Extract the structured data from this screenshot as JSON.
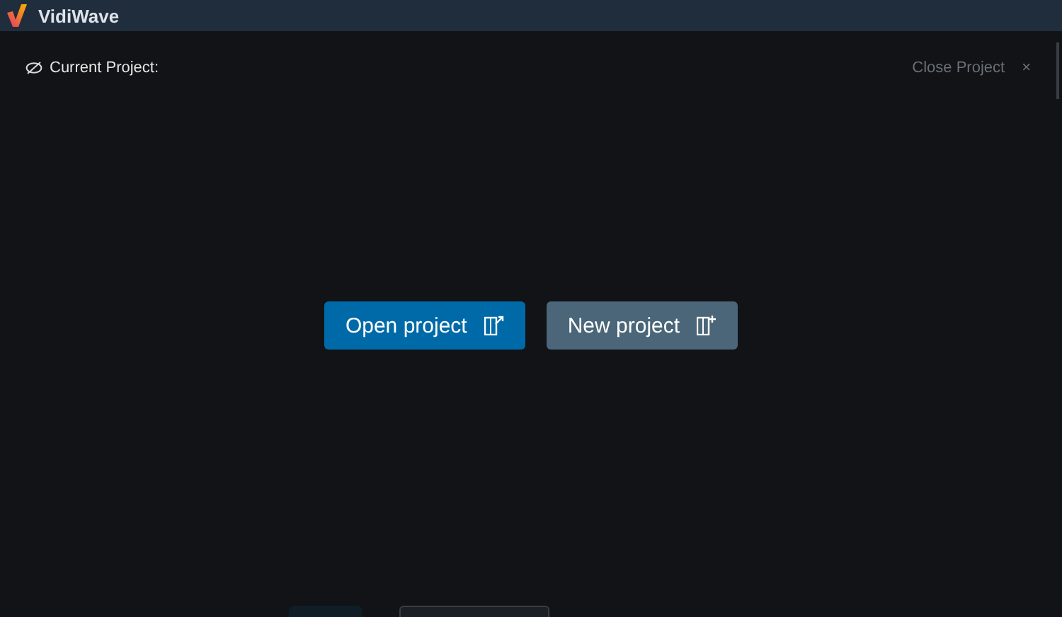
{
  "app": {
    "title": "VidiWave"
  },
  "project_bar": {
    "label": "Current Project:",
    "close_button": {
      "label": "Close Project",
      "icon": "×",
      "disabled": true
    }
  },
  "actions": [
    {
      "label": "Open project",
      "kind": "open"
    },
    {
      "label": "New project",
      "kind": "new"
    }
  ]
}
